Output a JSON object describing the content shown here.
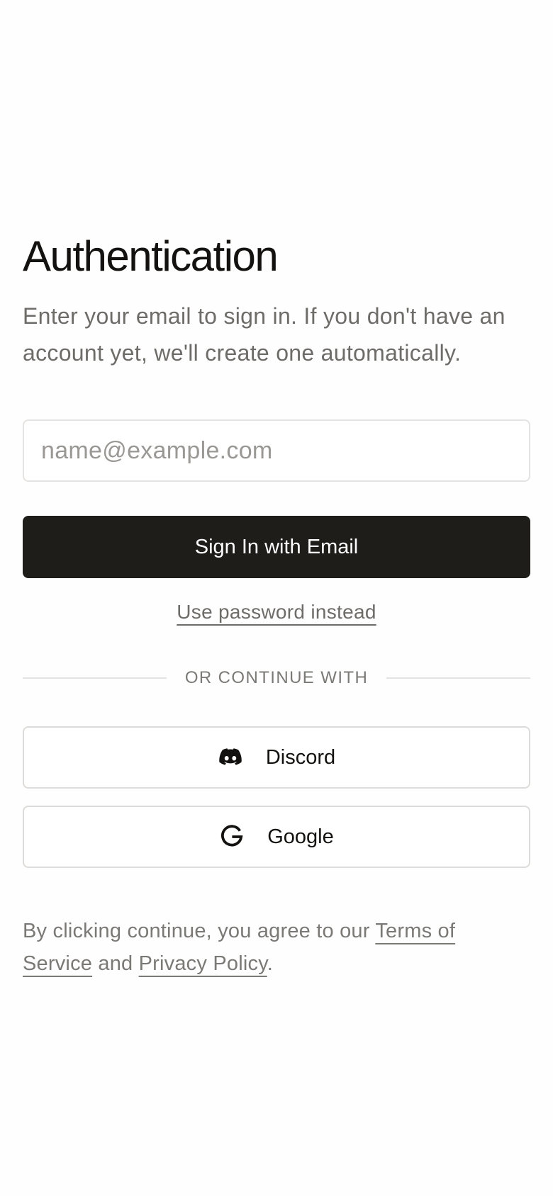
{
  "page": {
    "title": "Authentication",
    "subtitle": "Enter your email to sign in. If you don't have an account yet, we'll create one automatically."
  },
  "email_form": {
    "email_placeholder": "name@example.com",
    "email_value": "",
    "submit_label": "Sign In with Email",
    "password_link_label": "Use password instead"
  },
  "divider": {
    "label": "OR CONTINUE WITH"
  },
  "providers": [
    {
      "label": "Discord",
      "icon": "discord-icon"
    },
    {
      "label": "Google",
      "icon": "google-icon"
    }
  ],
  "legal": {
    "prefix": "By clicking continue, you agree to our ",
    "terms_label": "Terms of Service",
    "and_text": " and ",
    "privacy_label": "Privacy Policy",
    "suffix": "."
  },
  "colors": {
    "primary_button": "#1e1d1a",
    "text_primary": "#131210",
    "text_muted": "#6e6c69",
    "border": "#e4e3e1",
    "background": "#fefefe"
  }
}
